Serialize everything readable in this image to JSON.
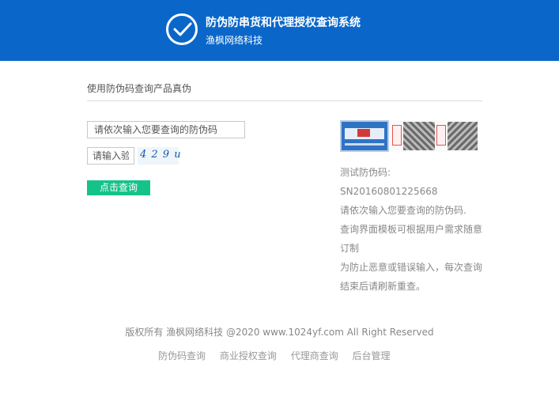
{
  "header": {
    "title": "防伪防串货和代理授权查询系统",
    "subtitle": "渔枫网络科技",
    "logo_icon": "check-circle-icon",
    "background": "#0a67c9"
  },
  "main": {
    "section_title": "使用防伪码查询产品真伪",
    "code_placeholder": "请依次输入您要查询的防伪码",
    "captcha_placeholder": "请输入验证码",
    "captcha_text": "4 2 9 u",
    "query_button": "点击查询",
    "button_color": "#15c38a"
  },
  "info": {
    "test_label": "测试防伪码:",
    "test_code": "SN20160801225668",
    "line1": "请依次输入您要查询的防伪码.",
    "line2a": "查询界面模板可根据用户需求随意",
    "line2b": "订制",
    "line3a": "为防止恶意或错误输入，每次查询",
    "line3b": "结束后请刷新重查。"
  },
  "footer": {
    "copyright": "版权所有 渔枫网络科技 @2020 www.1024yf.com All Right Reserved",
    "links": [
      "防伪码查询",
      "商业授权查询",
      "代理商查询",
      "后台管理"
    ]
  }
}
